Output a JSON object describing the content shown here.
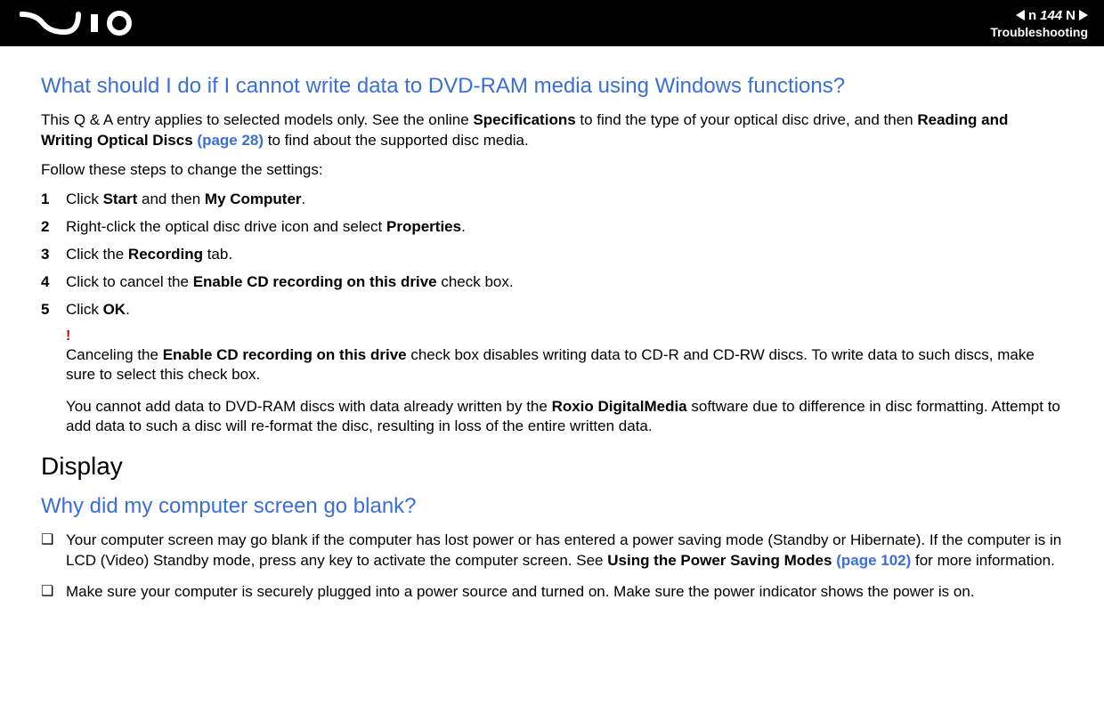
{
  "header": {
    "page_number": "144",
    "n_label": "n",
    "N_label": "N",
    "section": "Troubleshooting"
  },
  "q1": {
    "heading": "What should I do if I cannot write data to DVD-RAM media using Windows functions?",
    "intro_1a": "This Q & A entry applies to selected models only. See the online ",
    "intro_1b": "Specifications",
    "intro_1c": " to find the type of your optical disc drive, and then ",
    "intro_1d": "Reading and Writing Optical Discs",
    "intro_1e": " ",
    "intro_1f": "(page 28)",
    "intro_1g": " to find about the supported disc media.",
    "intro_2": "Follow these steps to change the settings:",
    "steps": [
      {
        "n": "1",
        "a": "Click ",
        "b": "Start",
        "c": " and then ",
        "d": "My Computer",
        "e": "."
      },
      {
        "n": "2",
        "a": "Right-click the optical disc drive icon and select ",
        "b": "Properties",
        "c": "."
      },
      {
        "n": "3",
        "a": "Click the ",
        "b": "Recording",
        "c": " tab."
      },
      {
        "n": "4",
        "a": "Click to cancel the ",
        "b": "Enable CD recording on this drive",
        "c": " check box."
      },
      {
        "n": "5",
        "a": "Click ",
        "b": "OK",
        "c": "."
      }
    ],
    "note_bang": "!",
    "note1_a": "Canceling the ",
    "note1_b": "Enable CD recording on this drive",
    "note1_c": " check box disables writing data to CD-R and CD-RW discs. To write data to such discs, make sure to select this check box.",
    "note2_a": "You cannot add data to DVD-RAM discs with data already written by the ",
    "note2_b": "Roxio DigitalMedia",
    "note2_c": " software due to difference in disc formatting. Attempt to add data to such a disc will re-format the disc, resulting in loss of the entire written data."
  },
  "section2": {
    "heading": "Display"
  },
  "q2": {
    "heading": "Why did my computer screen go blank?",
    "b1_a": "Your computer screen may go blank if the computer has lost power or has entered a power saving mode (Standby or Hibernate). If the computer is in LCD (Video) Standby mode, press any key to activate the computer screen. See ",
    "b1_b": "Using the Power Saving Modes",
    "b1_c": " ",
    "b1_d": "(page 102)",
    "b1_e": " for more information.",
    "b2": "Make sure your computer is securely plugged into a power source and turned on. Make sure the power indicator shows the power is on.",
    "bullet_glyph": "❑"
  }
}
